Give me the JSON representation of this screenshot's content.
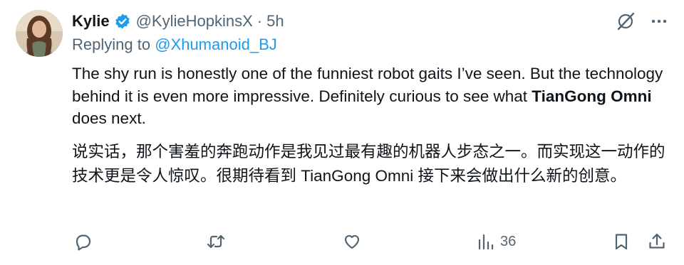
{
  "tweet": {
    "author_name": "Kylie",
    "handle": "@KylieHopkinsX",
    "separator": "·",
    "time": "5h",
    "replying_prefix": "Replying to",
    "replying_to": "@Xhumanoid_BJ",
    "text_en_1": "The shy run is honestly one of the funniest robot gaits I’ve seen. But the technology behind it is even more impressive. Definitely curious to see what ",
    "text_en_bold": "TianGong Omni",
    "text_en_2": " does next.",
    "text_zh": "说实话，那个害羞的奔跑动作是我见过最有趣的机器人步态之一。而实现这一动作的技术更是令人惊叹。很期待看到 TianGong Omni 接下来会做出什么新的创意。"
  },
  "actions": {
    "views_count": "36"
  },
  "icons": {
    "verified": "verified-badge-icon",
    "grok": "grok-icon",
    "more": "more-icon",
    "reply": "reply-icon",
    "retweet": "retweet-icon",
    "like": "like-icon",
    "views": "views-icon",
    "bookmark": "bookmark-icon",
    "share": "share-icon"
  },
  "colors": {
    "accent": "#1d9bf0",
    "secondary_text": "#536471",
    "primary_text": "#0f1419"
  }
}
